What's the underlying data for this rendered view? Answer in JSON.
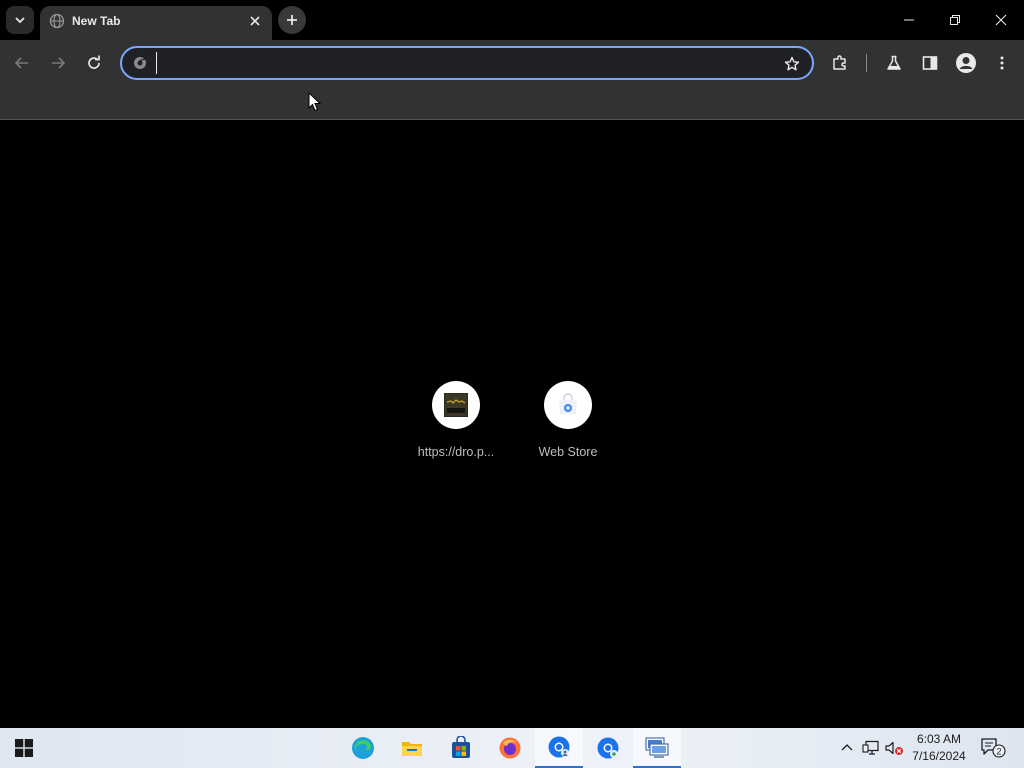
{
  "window": {
    "tab_title": "New Tab",
    "icons": {
      "tab_search": "chevron-down-icon",
      "tab_favicon": "globe-icon",
      "tab_close": "close-icon",
      "new_tab": "plus-icon",
      "minimize": "minimize-icon",
      "restore": "restore-icon",
      "close": "close-icon"
    }
  },
  "toolbar": {
    "omnibox_value": "",
    "omnibox_placeholder": "",
    "icons": [
      "back-arrow-icon",
      "forward-arrow-icon",
      "reload-icon",
      "star-icon",
      "puzzle-extension-icon",
      "flask-labs-icon",
      "side-panel-icon",
      "profile-avatar-icon",
      "more-vertical-icon"
    ]
  },
  "shortcuts": [
    {
      "label": "https://dro.p...",
      "icon": "site-thumbnail-icon"
    },
    {
      "label": "Web Store",
      "icon": "web-store-icon"
    }
  ],
  "taskbar": {
    "apps": [
      "windows-start-icon",
      "edge-icon",
      "file-explorer-icon",
      "microsoft-store-icon",
      "firefox-icon",
      "chrome-beta-icon",
      "chrome-beta-icon-2",
      "remote-desktop-icon"
    ],
    "clock": {
      "time": "6:03 AM",
      "date": "7/16/2024"
    },
    "notification_count": "2"
  },
  "colors": {
    "omnibox_focus_border": "#7aa7ff",
    "toolbar_bg": "#323232",
    "content_bg": "#000000"
  }
}
